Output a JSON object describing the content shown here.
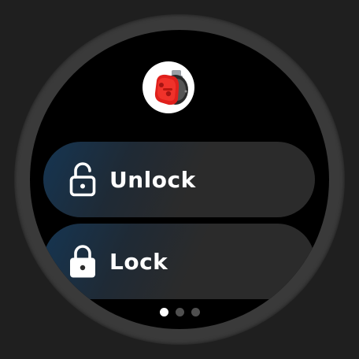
{
  "device": {
    "icon": "red-motor-device-image"
  },
  "actions": [
    {
      "label": "Unlock",
      "icon": "unlock-icon"
    },
    {
      "label": "Lock",
      "icon": "lock-icon"
    }
  ],
  "pagination": {
    "total": 3,
    "current": 1
  },
  "colors": {
    "background": "#1f1f1f",
    "bezel": "#3a3a3a",
    "screen": "#000000",
    "chip": "#2b2b2b",
    "chip_accent": "#153552",
    "text": "#ffffff",
    "dot_active": "#ffffff",
    "dot_inactive": "#4f4f4f"
  }
}
